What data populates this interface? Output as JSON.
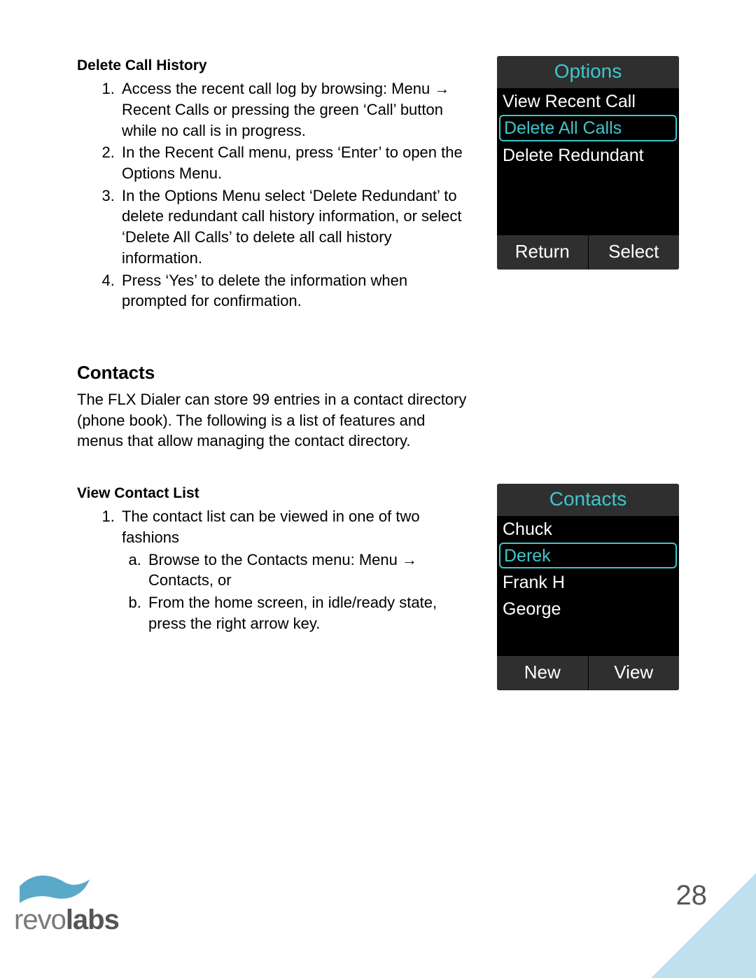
{
  "sections": {
    "delete_history": {
      "heading": "Delete Call History",
      "steps": [
        "Access the recent call log by browsing: Menu → Recent Calls or pressing the green ‘Call’ button while no call is in progress.",
        "In the Recent Call menu, press ‘Enter’ to open the Options Menu.",
        "In the Options Menu select ‘Delete Redundant’ to delete redundant call history information, or select ‘Delete All Calls’ to delete all call history information.",
        "Press ‘Yes’ to delete the information when prompted for confirmation."
      ]
    },
    "contacts": {
      "heading": "Contacts",
      "intro": "The FLX Dialer can store 99 entries in a contact directory (phone book). The following is a list of features and menus that allow managing the contact directory."
    },
    "view_list": {
      "heading": "View Contact List",
      "step1_lead": "The contact list can be viewed in one of two fashions",
      "substeps": [
        "Browse to the Contacts menu: Menu → Contacts, or",
        "From the home screen, in idle/ready state, press the right arrow key."
      ]
    }
  },
  "phone1": {
    "title": "Options",
    "items": [
      "View Recent Call",
      "Delete All Calls",
      "Delete Redundant"
    ],
    "selected_index": 1,
    "left_btn": "Return",
    "right_btn": "Select"
  },
  "phone2": {
    "title": "Contacts",
    "items": [
      "Chuck",
      "Derek",
      "Frank H",
      "George"
    ],
    "selected_index": 1,
    "left_btn": "New",
    "right_btn": "View"
  },
  "footer": {
    "logo_light": "revo",
    "logo_bold": "labs",
    "page": "28"
  }
}
